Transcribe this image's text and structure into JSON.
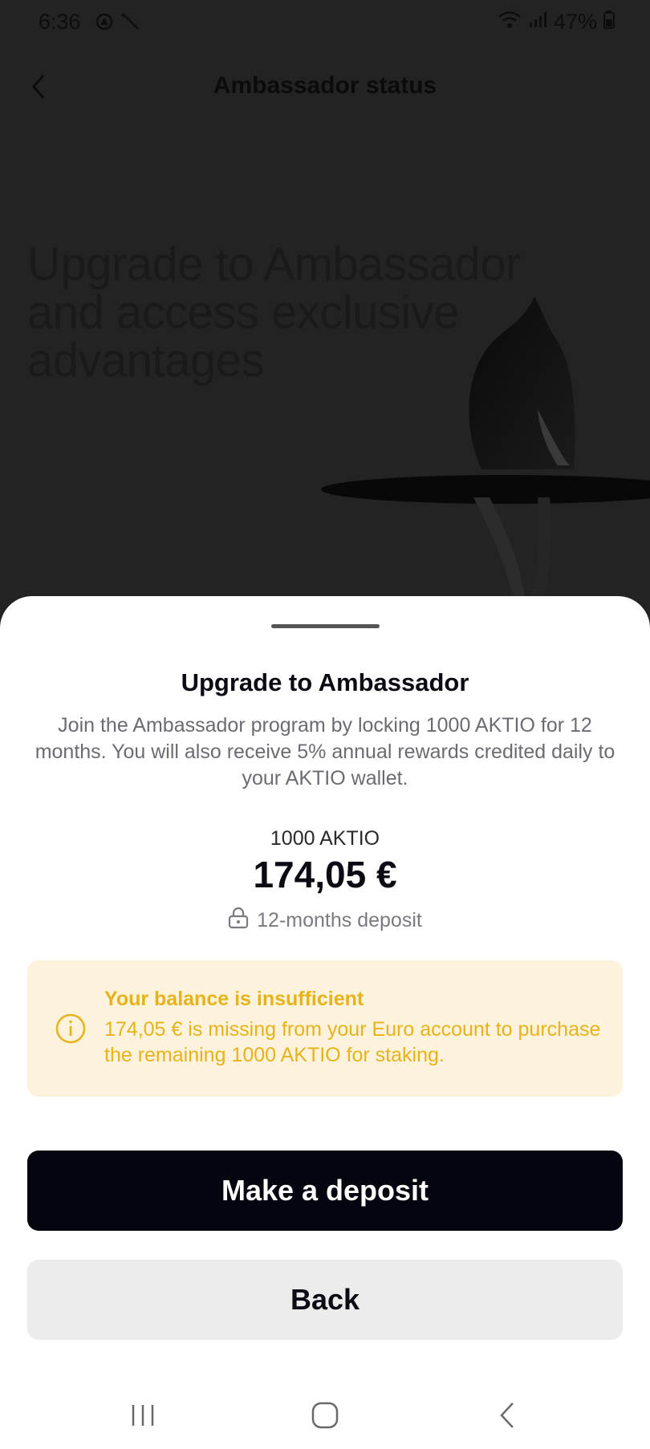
{
  "status_bar": {
    "time": "6:36",
    "battery": "47%",
    "icons": [
      "notification-icon",
      "wand-icon",
      "wifi-icon",
      "signal-icon",
      "battery-icon"
    ]
  },
  "header": {
    "title": "Ambassador status",
    "back_icon": "chevron-left-icon"
  },
  "hero": {
    "heading": "Upgrade to Ambassador and access exclusive advantages",
    "illustration": "chess-knight-illustration"
  },
  "sheet": {
    "title": "Upgrade to Ambassador",
    "description": "Join the Ambassador program by locking 1000 AKTIO for 12 months. You will also receive 5% annual rewards credited daily to your AKTIO wallet.",
    "amount_label": "1000 AKTIO",
    "amount_value": "174,05 €",
    "deposit_label": "12-months deposit",
    "warning": {
      "title": "Your balance is insufficient",
      "text": "174,05 € is missing from your Euro account to purchase the remaining 1000 AKTIO for staking.",
      "icon": "info-icon"
    },
    "primary_button": "Make a deposit",
    "secondary_button": "Back"
  },
  "nav_bar": {
    "items": [
      "recent-apps-icon",
      "home-icon",
      "back-icon"
    ]
  },
  "colors": {
    "overlay_bg": "#232323",
    "primary": "#05050f",
    "warning_bg": "#fdf3dc",
    "warning_text": "#e8b319",
    "secondary_bg": "#ececec"
  }
}
